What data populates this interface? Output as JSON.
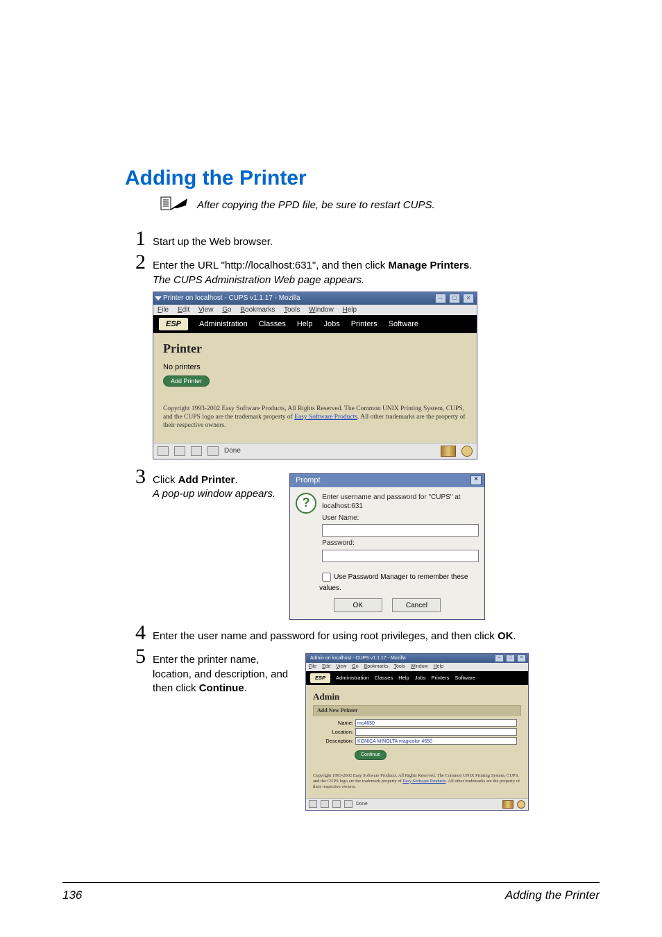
{
  "section_title": "Adding the Printer",
  "note": "After copying the PPD file, be sure to restart CUPS.",
  "steps": {
    "n1": "1",
    "n2": "2",
    "n3": "3",
    "n4": "4",
    "n5": "5",
    "s1": "Start up the Web browser.",
    "s2_a": "Enter the URL \"http://localhost:631\", and then click ",
    "s2_b": "Manage Printers",
    "s2_c": ".",
    "s2_italic": "The CUPS Administration Web page appears.",
    "s3_a": "Click ",
    "s3_b": "Add Printer",
    "s3_c": ".",
    "s3_italic": "A pop-up window appears.",
    "s4_a": "Enter the user name and password for using root privileges, and then click ",
    "s4_b": "OK",
    "s4_c": ".",
    "s5_a": "Enter the printer name, location, and description, and then click ",
    "s5_b": "Continue",
    "s5_c": "."
  },
  "browser": {
    "title": "Printer on localhost - CUPS v1.1.17 - Mozilla",
    "minimize": "–",
    "maximize": "□",
    "close": "×",
    "menu": {
      "file": "File",
      "edit": "Edit",
      "view": "View",
      "go": "Go",
      "bookmarks": "Bookmarks",
      "tools": "Tools",
      "window": "Window",
      "help": "Help"
    },
    "nav": {
      "esp": "ESP",
      "admin": "Administration",
      "classes": "Classes",
      "help": "Help",
      "jobs": "Jobs",
      "printers": "Printers",
      "software": "Software"
    },
    "heading": "Printer",
    "noprinters": "No printers",
    "addbtn": "Add Printer",
    "copyright_a": "Copyright 1993-2002 Easy Software Products, All Rights Reserved. The Common UNIX Printing System, CUPS, and the CUPS logo are the trademark property of ",
    "copyright_link": "Easy Software Products",
    "copyright_b": ". All other trademarks are the property of their respective owners.",
    "status_done": "Done"
  },
  "prompt": {
    "title": "Prompt",
    "close": "×",
    "qmark": "?",
    "msg": "Enter username and password for \"CUPS\" at localhost:631",
    "user_label": "User Name:",
    "pass_label": "Password:",
    "remember": "Use Password Manager to remember these values.",
    "ok": "OK",
    "cancel": "Cancel"
  },
  "admin": {
    "title": "Admin on localhost - CUPS v1.1.17 - Mozilla",
    "menu": {
      "file": "File",
      "edit": "Edit",
      "view": "View",
      "go": "Go",
      "bookmarks": "Bookmarks",
      "tools": "Tools",
      "window": "Window",
      "help": "Help"
    },
    "nav": {
      "esp": "ESP",
      "admin": "Administration",
      "classes": "Classes",
      "help": "Help",
      "jobs": "Jobs",
      "printers": "Printers",
      "software": "Software"
    },
    "heading": "Admin",
    "form_title": "Add New Printer",
    "name_label": "Name:",
    "name_value": "mc4650",
    "location_label": "Location:",
    "location_value": "",
    "desc_label": "Description:",
    "desc_value": "KONICA MINOLTA magicolor 4650",
    "continue": "Continue",
    "copyright_a": "Copyright 1993-2002 Easy Software Products, All Rights Reserved. The Common UNIX Printing System, CUPS, and the CUPS logo are the trademark property of ",
    "copyright_link": "Easy Software Products",
    "copyright_b": ". All other trademarks are the property of their respective owners.",
    "status_done": "Done"
  },
  "footer": {
    "page": "136",
    "title": "Adding the Printer"
  }
}
